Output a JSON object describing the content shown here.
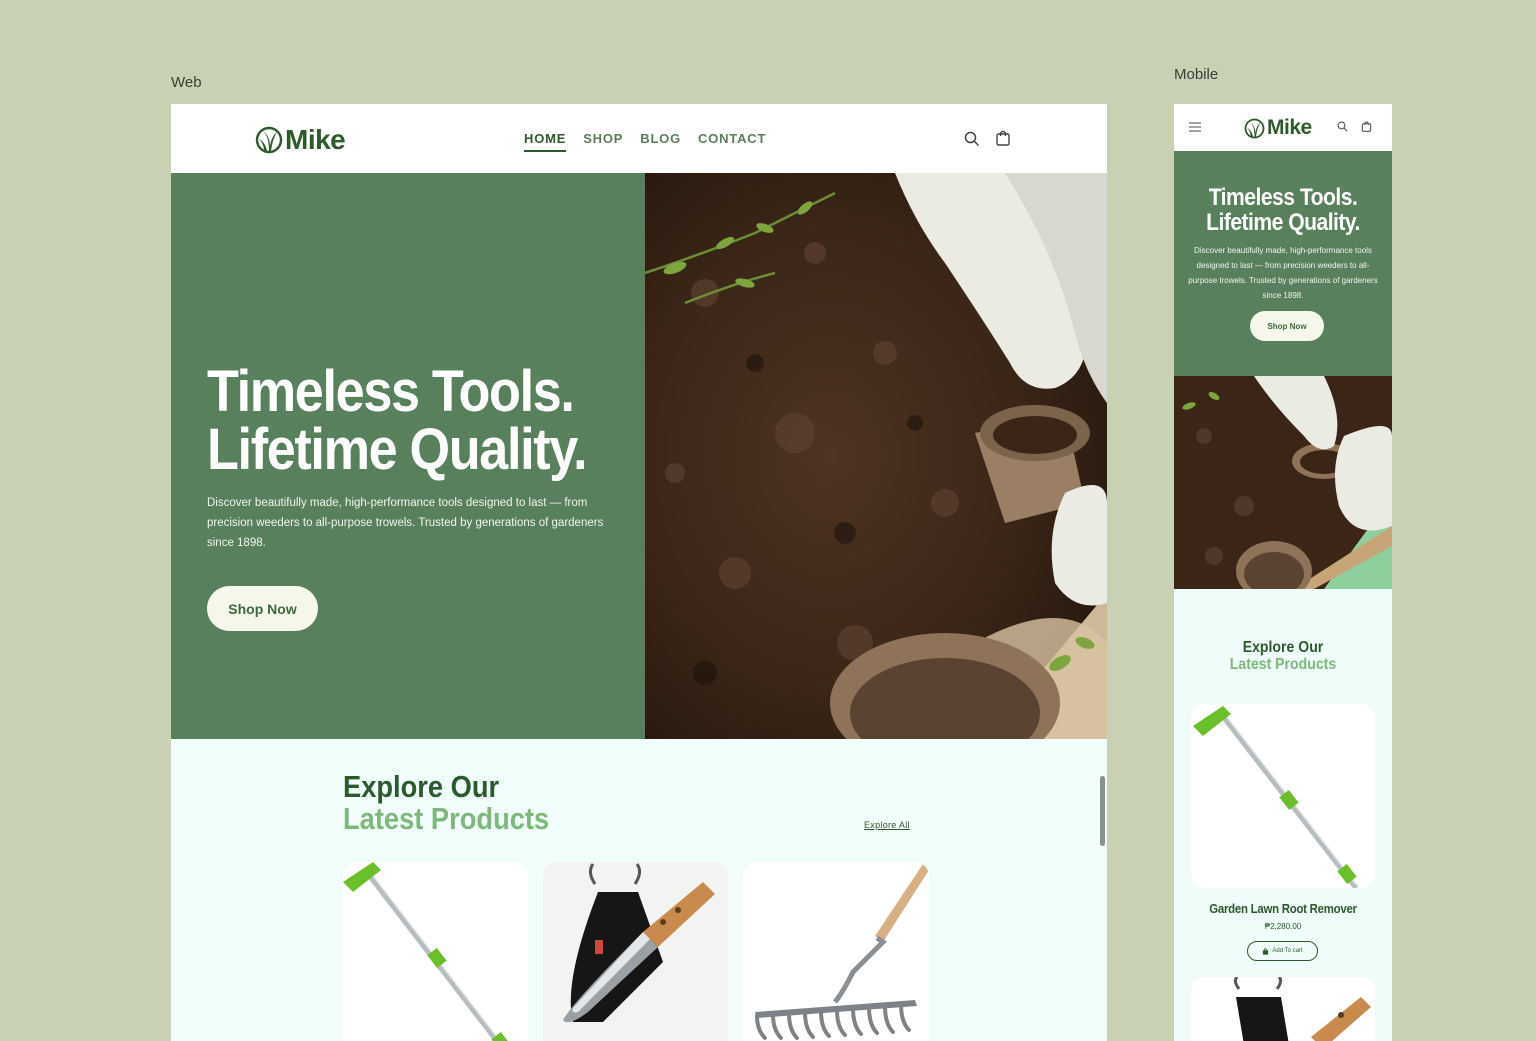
{
  "labels": {
    "web": "Web",
    "mobile": "Mobile"
  },
  "brand": {
    "name": "Mike",
    "primary": "#2f5a2c",
    "hero_green": "#58805c",
    "accent_light": "#7fb87c",
    "background": "#c8d1b3"
  },
  "nav": {
    "items": [
      {
        "label": "HOME",
        "active": true
      },
      {
        "label": "SHOP",
        "active": false
      },
      {
        "label": "BLOG",
        "active": false
      },
      {
        "label": "CONTACT",
        "active": false
      }
    ],
    "icons": [
      "search-icon",
      "cart-icon",
      "menu-icon"
    ]
  },
  "hero": {
    "title_line1": "Timeless Tools.",
    "title_line2": "Lifetime Quality.",
    "description": "Discover beautifully made, high-performance tools designed to last — from precision weeders to all-purpose trowels. Trusted by generations of gardeners since 1898.",
    "cta": "Shop Now"
  },
  "products_section": {
    "title_line1": "Explore Our",
    "title_line2": "Latest Products",
    "explore_all": "Explore All",
    "products": [
      {
        "name": "Garden Lawn Root Remover",
        "price": "₱2,280.00",
        "cta": "Add To cart"
      }
    ]
  }
}
